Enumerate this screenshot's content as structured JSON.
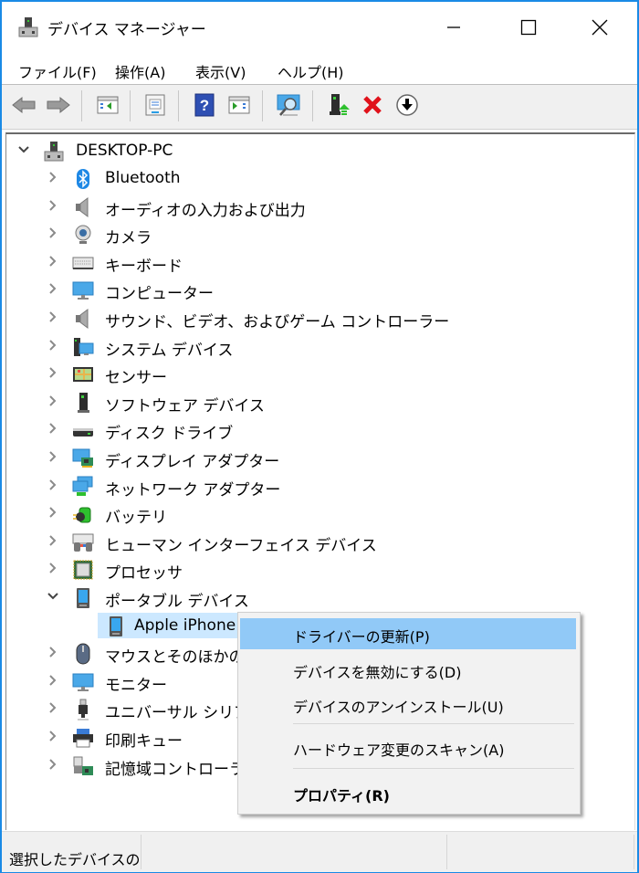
{
  "window": {
    "title": "デバイス マネージャー",
    "controls": {
      "minimize": "minimize",
      "maximize": "maximize",
      "close": "close"
    },
    "accent_color": "#1a8ae5"
  },
  "menubar": {
    "items": [
      {
        "label": "ファイル(F)"
      },
      {
        "label": "操作(A)"
      },
      {
        "label": "表示(V)"
      },
      {
        "label": "ヘルプ(H)"
      }
    ]
  },
  "toolbar": {
    "buttons": [
      {
        "icon": "back-arrow-icon"
      },
      {
        "icon": "forward-arrow-icon"
      },
      {
        "icon": "show-hide-console-tree-icon"
      },
      {
        "icon": "properties-icon"
      },
      {
        "icon": "help-icon"
      },
      {
        "icon": "show-action-pane-icon"
      },
      {
        "icon": "scan-hardware-changes-icon"
      },
      {
        "icon": "update-driver-icon"
      },
      {
        "icon": "uninstall-device-icon"
      },
      {
        "icon": "disable-device-icon"
      }
    ]
  },
  "tree": {
    "root": {
      "label": "DESKTOP-PC",
      "expanded": true,
      "icon": "computer-root-icon"
    },
    "categories": [
      {
        "label": "Bluetooth",
        "icon": "bluetooth-icon"
      },
      {
        "label": "オーディオの入力および出力",
        "icon": "speaker-icon"
      },
      {
        "label": "カメラ",
        "icon": "webcam-icon"
      },
      {
        "label": "キーボード",
        "icon": "keyboard-icon"
      },
      {
        "label": "コンピューター",
        "icon": "monitor-icon"
      },
      {
        "label": "サウンド、ビデオ、およびゲーム コントローラー",
        "icon": "speaker-icon"
      },
      {
        "label": "システム デバイス",
        "icon": "system-devices-icon"
      },
      {
        "label": "センサー",
        "icon": "sensor-icon"
      },
      {
        "label": "ソフトウェア デバイス",
        "icon": "software-device-icon"
      },
      {
        "label": "ディスク ドライブ",
        "icon": "disk-drive-icon"
      },
      {
        "label": "ディスプレイ アダプター",
        "icon": "display-adapter-icon"
      },
      {
        "label": "ネットワーク アダプター",
        "icon": "network-adapter-icon"
      },
      {
        "label": "バッテリ",
        "icon": "battery-icon"
      },
      {
        "label": "ヒューマン インターフェイス デバイス",
        "icon": "hid-icon"
      },
      {
        "label": "プロセッサ",
        "icon": "processor-icon"
      },
      {
        "label": "ポータブル デバイス",
        "icon": "portable-device-icon",
        "expanded": true,
        "children": [
          {
            "label": "Apple iPhone",
            "icon": "portable-device-icon",
            "selected": true
          }
        ]
      },
      {
        "label": "マウスとそのほかのポインティング デバイス",
        "icon": "mouse-icon"
      },
      {
        "label": "モニター",
        "icon": "monitor-icon"
      },
      {
        "label": "ユニバーサル シリアル バス コントローラー",
        "icon": "usb-icon"
      },
      {
        "label": "印刷キュー",
        "icon": "printer-icon"
      },
      {
        "label": "記憶域コントローラー",
        "icon": "storage-controller-icon"
      }
    ]
  },
  "context_menu": {
    "items": [
      {
        "label": "ドライバーの更新(P)",
        "highlighted": true
      },
      {
        "label": "デバイスを無効にする(D)"
      },
      {
        "label": "デバイスのアンインストール(U)"
      },
      {
        "separator": true
      },
      {
        "label": "ハードウェア変更のスキャン(A)"
      },
      {
        "separator": true
      },
      {
        "label": "プロパティ(R)",
        "bold": true
      }
    ],
    "highlight_color": "#91c9f7"
  },
  "statusbar": {
    "text": "選択したデバイスの"
  }
}
